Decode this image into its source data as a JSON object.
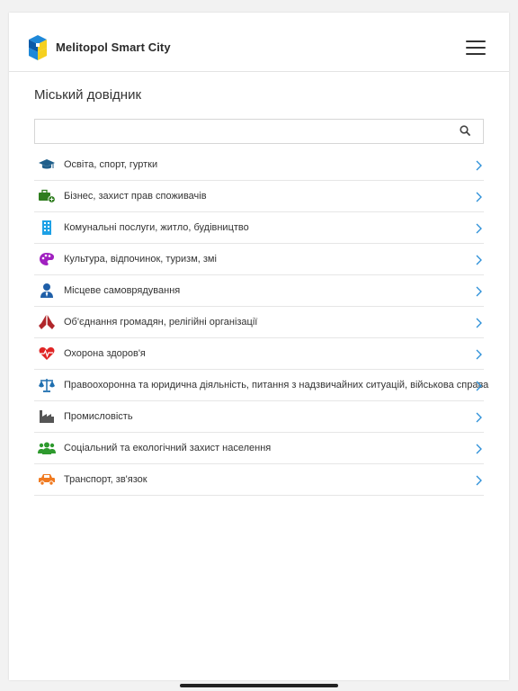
{
  "header": {
    "brand": "Melitopol Smart City",
    "logo_icon": "melitopol-logo-icon",
    "menu_icon": "hamburger-menu-icon"
  },
  "page": {
    "title": "Міський довідник"
  },
  "search": {
    "value": "",
    "placeholder": "",
    "icon": "search-icon"
  },
  "categories": [
    {
      "label": "Освіта, спорт, гуртки",
      "icon": "graduation-cap-icon",
      "color": "#1f5f8b"
    },
    {
      "label": "Бізнес, захист прав споживачів",
      "icon": "briefcase-icon",
      "color": "#2e7d1e"
    },
    {
      "label": "Комунальні послуги, житло, будівництво",
      "icon": "building-icon",
      "color": "#1ea1e6"
    },
    {
      "label": "Культура, відпочинок, туризм, змі",
      "icon": "palette-icon",
      "color": "#a020c0"
    },
    {
      "label": "Місцеве самоврядування",
      "icon": "official-person-icon",
      "color": "#1f5fa8"
    },
    {
      "label": "Об'єднання громадян, релігійні організації",
      "icon": "praying-hands-icon",
      "color": "#b0262a"
    },
    {
      "label": "Охорона здоров'я",
      "icon": "heartbeat-icon",
      "color": "#e02424"
    },
    {
      "label": "Правоохоронна та юридична діяльність, питання з надзвичайних ситуацій, військова справа",
      "icon": "scales-icon",
      "color": "#1f6fb0"
    },
    {
      "label": "Промисловість",
      "icon": "factory-icon",
      "color": "#555555"
    },
    {
      "label": "Соціальний та екологічний захист населення",
      "icon": "people-group-icon",
      "color": "#2e9a2e"
    },
    {
      "label": "Транспорт, зв'язок",
      "icon": "car-icon",
      "color": "#f07a20"
    }
  ],
  "colors": {
    "chevron": "#2a8fd8",
    "text": "#333333",
    "divider": "#e6e6e6"
  }
}
